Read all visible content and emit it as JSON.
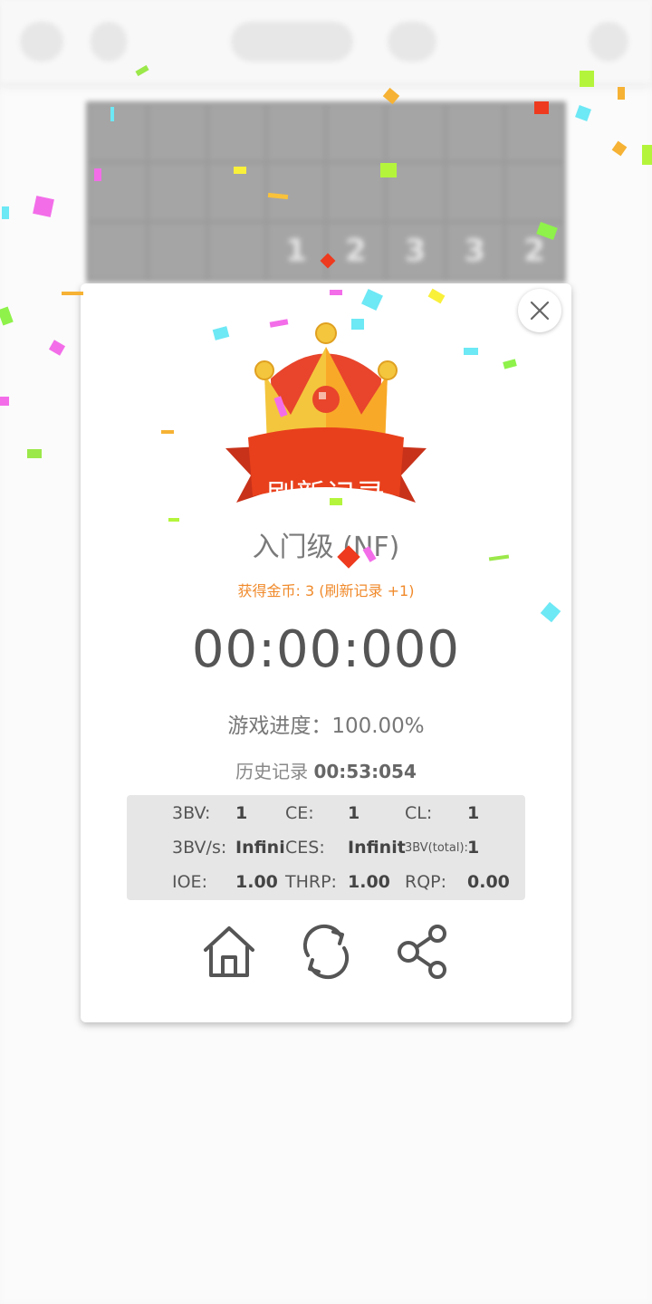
{
  "background": {
    "board_numbers": [
      "1",
      "2",
      "3",
      "3",
      "2"
    ]
  },
  "dialog": {
    "banner": "刷新记录",
    "level": "入门级 (NF)",
    "coins": "获得金币: 3 (刷新记录 +1)",
    "time": "00:00:000",
    "progress": "游戏进度：100.00%",
    "history_label": "历史记录",
    "history_value": "00:53:054",
    "stats": {
      "bv_label": "3BV:",
      "bv_value": "1",
      "ce_label": "CE:",
      "ce_value": "1",
      "cl_label": "CL:",
      "cl_value": "1",
      "bvs_label": "3BV/s:",
      "bvs_value": "Infini",
      "ces_label": "CES:",
      "ces_value": "Infinit",
      "bvtotal_label": "3BV(total):",
      "bvtotal_value": "1",
      "ioe_label": "IOE:",
      "ioe_value": "1.00",
      "thrp_label": "THRP:",
      "thrp_value": "1.00",
      "rqp_label": "RQP:",
      "rqp_value": "0.00"
    }
  },
  "icons": {
    "close": "close-icon",
    "home": "home-icon",
    "restart": "restart-icon",
    "share": "share-icon"
  },
  "colors": {
    "banner_red": "#e8401c",
    "crown_gold": "#f8b52a",
    "coins_orange": "#f08a2b",
    "stats_bg": "#e6e6e6"
  }
}
